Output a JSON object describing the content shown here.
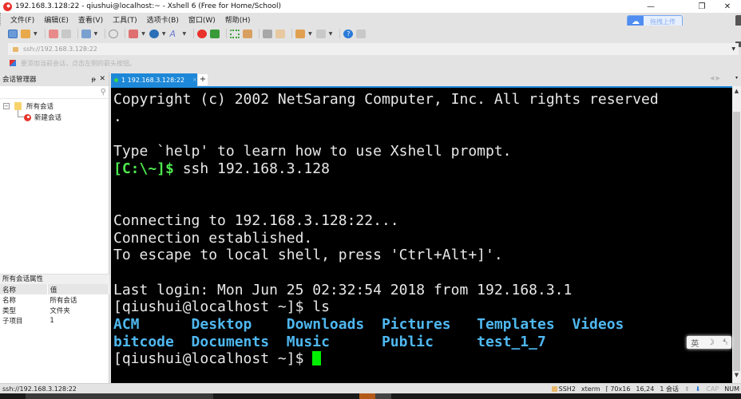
{
  "window": {
    "title": "192.168.3.128:22 - qiushui@localhost:~ - Xshell 6 (Free for Home/School)",
    "minimize": "—",
    "restore": "❐",
    "close": "✕"
  },
  "menu": [
    "文件(F)",
    "编辑(E)",
    "查看(V)",
    "工具(T)",
    "选项卡(B)",
    "窗口(W)",
    "帮助(H)"
  ],
  "toolbar": {
    "upload_label": "拖拽上传",
    "icons": [
      "new-session",
      "open-folder",
      "disconnect",
      "reconnect",
      "session-properties",
      "find",
      "copy-paste",
      "globe",
      "font",
      "xshell-logo",
      "xftp",
      "fullscreen",
      "lock",
      "keyboard",
      "highlight",
      "new-folder",
      "layout",
      "help",
      "chat"
    ]
  },
  "addressbar": {
    "url": "ssh://192.168.3.128:22"
  },
  "hint": "要添加当前会话，点击左侧的箭头按钮。",
  "sidebar": {
    "title": "会话管理器",
    "pin": "ᵽ",
    "close": "✕",
    "search_placeholder": "",
    "tree": [
      {
        "label": "所有会话",
        "toggle": "−"
      },
      {
        "label": "新建会话"
      }
    ]
  },
  "properties": {
    "title": "所有会话属性",
    "headers": [
      "名称",
      "值"
    ],
    "rows": [
      [
        "名称",
        "所有会话"
      ],
      [
        "类型",
        "文件夹"
      ],
      [
        "子项目",
        "1"
      ]
    ]
  },
  "tabs": [
    {
      "label": "1 192.168.3.128:22",
      "active": true,
      "close": "×"
    }
  ],
  "tab_add": "+",
  "tab_nav": "◀ ▶",
  "tab_menu": "▾",
  "terminal": {
    "lines": [
      {
        "text": "Copyright (c) 2002 NetSarang Computer, Inc. All rights reserved"
      },
      {
        "text": "."
      },
      {
        "text": ""
      },
      {
        "text": "Type `help' to learn how to use Xshell prompt."
      },
      {
        "prompt": "[C:\\~]$",
        "text": " ssh 192.168.3.128"
      },
      {
        "text": ""
      },
      {
        "text": ""
      },
      {
        "text": "Connecting to 192.168.3.128:22..."
      },
      {
        "text": "Connection established."
      },
      {
        "text": "To escape to local shell, press 'Ctrl+Alt+]'."
      },
      {
        "text": ""
      },
      {
        "text": "Last login: Mon Jun 25 02:32:54 2018 from 192.168.3.1"
      },
      {
        "text": "[qiushui@localhost ~]$ ls"
      },
      {
        "ls": "ACM      Desktop    Downloads  Pictures   Templates  Videos"
      },
      {
        "ls": "bitcode  Documents  Music      Public     test_1_7"
      },
      {
        "text": "[qiushui@localhost ~]$ ",
        "cursor": true
      }
    ]
  },
  "ime": {
    "lang": "英",
    "moon": "☽",
    "punct": "⁴ₗ"
  },
  "status": {
    "left": "ssh://192.168.3.128:22",
    "protocol": "SSH2",
    "term": "xterm",
    "size": "70x16",
    "pos": "16,24",
    "sessions": "1 会话",
    "cap": "CAP",
    "num": "NUM"
  },
  "colors": {
    "accent": "#1e88d8",
    "terminal_bg": "#000000",
    "prompt_green": "#4ee84e",
    "dir_blue": "#4fb8f0",
    "cursor": "#00ee00"
  }
}
